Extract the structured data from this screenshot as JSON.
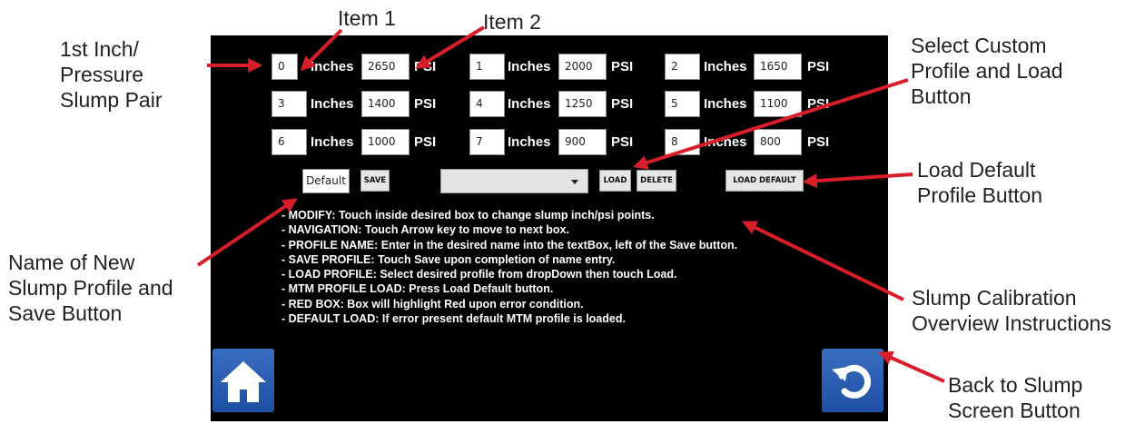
{
  "callouts": {
    "pair": [
      "1st Inch/",
      "Pressure",
      "Slump Pair"
    ],
    "item1": "Item 1",
    "item2": "Item 2",
    "select_custom": [
      "Select Custom",
      "Profile and Load",
      "Button"
    ],
    "load_default": [
      "Load Default",
      "Profile Button"
    ],
    "name_new": [
      "Name of New",
      "Slump Profile and",
      "Save Button"
    ],
    "overview": [
      "Slump Calibration",
      "Overview Instructions"
    ],
    "back": [
      "Back to Slump",
      "Screen Button"
    ]
  },
  "pairs": [
    {
      "index": "0",
      "inches_label": "Inches",
      "psi": "2650",
      "psi_label": "PSI"
    },
    {
      "index": "1",
      "inches_label": "Inches",
      "psi": "2000",
      "psi_label": "PSI"
    },
    {
      "index": "2",
      "inches_label": "Inches",
      "psi": "1650",
      "psi_label": "PSI"
    },
    {
      "index": "3",
      "inches_label": "Inches",
      "psi": "1400",
      "psi_label": "PSI"
    },
    {
      "index": "4",
      "inches_label": "Inches",
      "psi": "1250",
      "psi_label": "PSI"
    },
    {
      "index": "5",
      "inches_label": "Inches",
      "psi": "1100",
      "psi_label": "PSI"
    },
    {
      "index": "6",
      "inches_label": "Inches",
      "psi": "1000",
      "psi_label": "PSI"
    },
    {
      "index": "7",
      "inches_label": "Inches",
      "psi": "900",
      "psi_label": "PSI"
    },
    {
      "index": "8",
      "inches_label": "Inches",
      "psi": "800",
      "psi_label": "PSI"
    }
  ],
  "profile": {
    "name_value": "Default",
    "save_label": "SAVE",
    "dropdown_value": "",
    "load_label": "LOAD",
    "delete_label": "DELETE",
    "load_default_label": "LOAD DEFAULT"
  },
  "instructions": [
    "- MODIFY: Touch inside desired box to change slump inch/psi points.",
    "- NAVIGATION: Touch Arrow key to move to next box.",
    "- PROFILE NAME: Enter in the desired name into the textBox, left of the Save button.",
    "- SAVE PROFILE: Touch Save upon completion of name entry.",
    "- LOAD PROFILE: Select desired profile from dropDown then touch Load.",
    "- MTM PROFILE LOAD: Press Load Default button.",
    "- RED BOX: Box will highlight Red upon error condition.",
    "- DEFAULT LOAD: If error present default MTM profile is loaded."
  ],
  "icons": {
    "home": "home-icon",
    "back": "refresh-back-icon"
  },
  "colors": {
    "arrow": "#d81e2a",
    "screen_bg": "#000000",
    "nav_button": "#2a5db0",
    "text": "#231f20"
  }
}
